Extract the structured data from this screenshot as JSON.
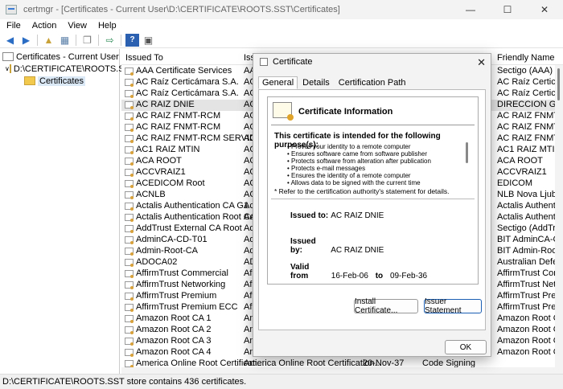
{
  "window": {
    "title": "certmgr - [Certificates - Current User\\D:\\CERTIFICATE\\ROOTS.SST\\Certificates]",
    "minimize": "—",
    "maximize": "☐",
    "close": "✕"
  },
  "menu": [
    "File",
    "Action",
    "View",
    "Help"
  ],
  "tree": {
    "root": "Certificates - Current User",
    "store": "D:\\CERTIFICATE\\ROOTS.SST",
    "folder": "Certificates"
  },
  "list": {
    "columns": [
      "Issued To",
      "Iss",
      "Friendly Name"
    ],
    "rows": [
      {
        "issued_to": "AAA Certificate Services",
        "issuer": "AA",
        "friendly": "Sectigo (AAA)"
      },
      {
        "issued_to": "AC Raíz Certicámara S.A.",
        "issuer": "AC",
        "friendly": "AC Raíz Certicám"
      },
      {
        "issued_to": "AC Raíz Certicámara S.A.",
        "issuer": "AC",
        "friendly": "AC Raíz Certicám"
      },
      {
        "issued_to": "AC RAIZ DNIE",
        "issuer": "AC",
        "friendly": "DIRECCION GENE"
      },
      {
        "issued_to": "AC RAIZ FNMT-RCM",
        "issuer": "AC",
        "friendly": "AC RAIZ FNMT-R"
      },
      {
        "issued_to": "AC RAIZ FNMT-RCM",
        "issuer": "AC",
        "friendly": "AC RAIZ FNMT-R"
      },
      {
        "issued_to": "AC RAIZ FNMT-RCM SERVIDOR...",
        "issuer": "AC",
        "friendly": "AC RAIZ FNMT-R"
      },
      {
        "issued_to": "AC1 RAIZ MTIN",
        "issuer": "AC",
        "friendly": "AC1 RAIZ MTIN"
      },
      {
        "issued_to": "ACA ROOT",
        "issuer": "AC",
        "friendly": "ACA ROOT"
      },
      {
        "issued_to": "ACCVRAIZ1",
        "issuer": "AC",
        "friendly": "ACCVRAIZ1"
      },
      {
        "issued_to": "ACEDICOM Root",
        "issuer": "AC",
        "friendly": "EDICOM"
      },
      {
        "issued_to": "ACNLB",
        "issuer": "AC",
        "friendly": "NLB Nova Ljublja"
      },
      {
        "issued_to": "Actalis Authentication CA G1",
        "issuer": "Ac",
        "friendly": "Actalis Authentic"
      },
      {
        "issued_to": "Actalis Authentication Root CA",
        "issuer": "Ac",
        "friendly": "Actalis Authentic"
      },
      {
        "issued_to": "AddTrust External CA Root",
        "issuer": "Ad",
        "friendly": "Sectigo (AddTrust"
      },
      {
        "issued_to": "AdminCA-CD-T01",
        "issuer": "Ad",
        "friendly": "BIT AdminCA-CD"
      },
      {
        "issued_to": "Admin-Root-CA",
        "issuer": "Ad",
        "friendly": "BIT Admin-Root-"
      },
      {
        "issued_to": "ADOCA02",
        "issuer": "AD",
        "friendly": "Australian Defenc"
      },
      {
        "issued_to": "AffirmTrust Commercial",
        "issuer": "Af",
        "friendly": "AffirmTrust Comr"
      },
      {
        "issued_to": "AffirmTrust Networking",
        "issuer": "Af",
        "friendly": "AffirmTrust Netw"
      },
      {
        "issued_to": "AffirmTrust Premium",
        "issuer": "Af",
        "friendly": "AffirmTrust Prem"
      },
      {
        "issued_to": "AffirmTrust Premium ECC",
        "issuer": "Af",
        "friendly": "AffirmTrust Prem"
      },
      {
        "issued_to": "Amazon Root CA 1",
        "issuer": "Am",
        "friendly": "Amazon Root CA"
      },
      {
        "issued_to": "Amazon Root CA 2",
        "issuer": "Am",
        "friendly": "Amazon Root CA"
      },
      {
        "issued_to": "Amazon Root CA 3",
        "issuer": "Am",
        "friendly": "Amazon Root CA"
      },
      {
        "issued_to": "Amazon Root CA 4",
        "issuer": "Am",
        "friendly": "Amazon Root CA"
      },
      {
        "issued_to": "America Online Root Certificati...",
        "issuer": "America Online Root Certification...",
        "friendly": ""
      }
    ],
    "partial_row_extra": {
      "date": "20-Nov-37",
      "purpose": "Code Signing"
    }
  },
  "status": "D:\\CERTIFICATE\\ROOTS.SST store contains 436 certificates.",
  "dialog": {
    "title": "Certificate",
    "close": "✕",
    "tabs": [
      "General",
      "Details",
      "Certification Path"
    ],
    "info_title": "Certificate Information",
    "purpose_title": "This certificate is intended for the following purpose(s):",
    "purposes": [
      "Proves your identity to a remote computer",
      "Ensures software came from software publisher",
      "Protects software from alteration after publication",
      "Protects e-mail messages",
      "Ensures the identity of a remote computer",
      "Allows data to be signed with the current time"
    ],
    "footnote": "* Refer to the certification authority's statement for details.",
    "issued_to_label": "Issued to:",
    "issued_to_value": "AC RAIZ DNIE",
    "issued_by_label": "Issued by:",
    "issued_by_value": "AC RAIZ DNIE",
    "valid_from_label": "Valid from",
    "valid_from_value": "16-Feb-06",
    "valid_to_label": "to",
    "valid_to_value": "09-Feb-36",
    "install_button": "Install Certificate...",
    "issuer_statement_button": "Issuer Statement",
    "ok_button": "OK"
  }
}
